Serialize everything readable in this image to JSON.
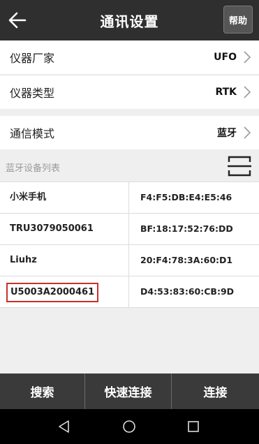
{
  "header": {
    "title": "通讯设置",
    "help_label": "帮助"
  },
  "settings": [
    {
      "label": "仪器厂家",
      "value": "UFO"
    },
    {
      "label": "仪器类型",
      "value": "RTK"
    },
    {
      "label": "通信模式",
      "value": "蓝牙"
    }
  ],
  "device_list": {
    "header": "蓝牙设备列表",
    "devices": [
      {
        "name": "小米手机",
        "mac": "F4:F5:DB:E4:E5:46",
        "selected": false
      },
      {
        "name": "TRU3079050061",
        "mac": "BF:18:17:52:76:DD",
        "selected": false
      },
      {
        "name": "Liuhz",
        "mac": "20:F4:78:3A:60:D1",
        "selected": false
      },
      {
        "name": "U5003A2000461",
        "mac": "D4:53:83:60:CB:9D",
        "selected": true
      }
    ]
  },
  "actions": {
    "search": "搜索",
    "quick_connect": "快速连接",
    "connect": "连接"
  },
  "colors": {
    "topbar": "#2f2f2f",
    "actionbar": "#3a3a3a",
    "selection_border": "#c9302c"
  },
  "icons": {
    "back": "back-arrow-icon",
    "chevron": "chevron-right-icon",
    "scan": "scan-icon"
  }
}
